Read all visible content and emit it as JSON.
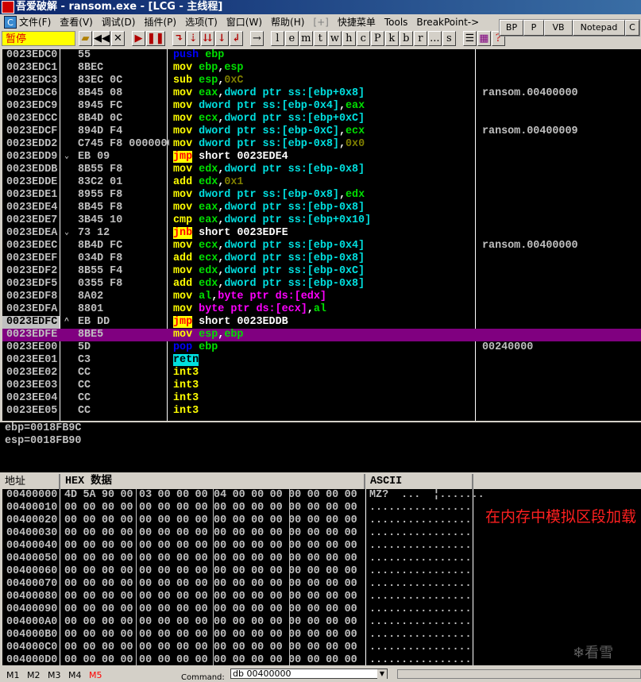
{
  "window": {
    "title": "吾爱破解 - ransom.exe - [LCG -  主线程]",
    "logo": "吾爱破解"
  },
  "menu": {
    "icon": "C",
    "items": [
      "文件(F)",
      "查看(V)",
      "调试(D)",
      "插件(P)",
      "选项(T)",
      "窗口(W)",
      "帮助(H)",
      "[+]",
      "快捷菜单",
      "Tools",
      "BreakPoint->"
    ]
  },
  "toolbar": {
    "state": "暂停",
    "buttons": [
      "l",
      "e",
      "m",
      "t",
      "w",
      "h",
      "c",
      "P",
      "k",
      "b",
      "r",
      "...",
      "s"
    ],
    "float_buttons": [
      "BP",
      "P",
      "VB",
      "Notepad",
      "C"
    ]
  },
  "disasm": {
    "colors": {
      "selected_row": "#800080",
      "mnemonic": "#ffff00",
      "register": "#00e000",
      "memory": "#00e0e0"
    },
    "rows": [
      {
        "addr": "0023EDC0",
        "mark": "",
        "hex": "55",
        "t": [
          [
            "push",
            "b"
          ],
          [
            " ",
            ""
          ],
          [
            "ebp",
            "g"
          ]
        ],
        "cmt": ""
      },
      {
        "addr": "0023EDC1",
        "mark": "",
        "hex": "8BEC",
        "t": [
          [
            "mov",
            "y"
          ],
          [
            " ",
            ""
          ],
          [
            "ebp",
            "g"
          ],
          [
            ",",
            "w"
          ],
          [
            "esp",
            "g"
          ]
        ],
        "cmt": ""
      },
      {
        "addr": "0023EDC3",
        "mark": "",
        "hex": "83EC 0C",
        "t": [
          [
            "sub",
            "y"
          ],
          [
            " ",
            ""
          ],
          [
            "esp",
            "g"
          ],
          [
            ",",
            "w"
          ],
          [
            "0xC",
            "o"
          ]
        ],
        "cmt": ""
      },
      {
        "addr": "0023EDC6",
        "mark": "",
        "hex": "8B45 08",
        "t": [
          [
            "mov",
            "y"
          ],
          [
            " ",
            ""
          ],
          [
            "eax",
            "g"
          ],
          [
            ",",
            "w"
          ],
          [
            "dword ptr ss:[ebp+0x8]",
            "cy"
          ]
        ],
        "cmt": "ransom.00400000"
      },
      {
        "addr": "0023EDC9",
        "mark": "",
        "hex": "8945 FC",
        "t": [
          [
            "mov",
            "y"
          ],
          [
            " ",
            ""
          ],
          [
            "dword ptr ss:[ebp-0x4]",
            "cy"
          ],
          [
            ",",
            "w"
          ],
          [
            "eax",
            "g"
          ]
        ],
        "cmt": ""
      },
      {
        "addr": "0023EDCC",
        "mark": "",
        "hex": "8B4D 0C",
        "t": [
          [
            "mov",
            "y"
          ],
          [
            " ",
            ""
          ],
          [
            "ecx",
            "g"
          ],
          [
            ",",
            "w"
          ],
          [
            "dword ptr ss:[ebp+0xC]",
            "cy"
          ]
        ],
        "cmt": ""
      },
      {
        "addr": "0023EDCF",
        "mark": "",
        "hex": "894D F4",
        "t": [
          [
            "mov",
            "y"
          ],
          [
            " ",
            ""
          ],
          [
            "dword ptr ss:[ebp-0xC]",
            "cy"
          ],
          [
            ",",
            "w"
          ],
          [
            "ecx",
            "g"
          ]
        ],
        "cmt": "ransom.00400009"
      },
      {
        "addr": "0023EDD2",
        "mark": "",
        "hex": "C745 F8 00000000",
        "t": [
          [
            "mov",
            "y"
          ],
          [
            " ",
            ""
          ],
          [
            "dword ptr ss:[ebp-0x8]",
            "cy"
          ],
          [
            ",",
            "w"
          ],
          [
            "0x0",
            "o"
          ]
        ],
        "cmt": ""
      },
      {
        "addr": "0023EDD9",
        "mark": "⌄",
        "hex": "EB 09",
        "t": [
          [
            "jmp",
            "jmp"
          ],
          [
            " ",
            ""
          ],
          [
            "short 0023EDE4",
            "w"
          ]
        ],
        "cmt": ""
      },
      {
        "addr": "0023EDDB",
        "mark": "",
        "hex": "8B55 F8",
        "t": [
          [
            "mov",
            "y"
          ],
          [
            " ",
            ""
          ],
          [
            "edx",
            "g"
          ],
          [
            ",",
            "w"
          ],
          [
            "dword ptr ss:[ebp-0x8]",
            "cy"
          ]
        ],
        "cmt": ""
      },
      {
        "addr": "0023EDDE",
        "mark": "",
        "hex": "83C2 01",
        "t": [
          [
            "add",
            "y"
          ],
          [
            " ",
            ""
          ],
          [
            "edx",
            "g"
          ],
          [
            ",",
            "w"
          ],
          [
            "0x1",
            "o"
          ]
        ],
        "cmt": ""
      },
      {
        "addr": "0023EDE1",
        "mark": "",
        "hex": "8955 F8",
        "t": [
          [
            "mov",
            "y"
          ],
          [
            " ",
            ""
          ],
          [
            "dword ptr ss:[ebp-0x8]",
            "cy"
          ],
          [
            ",",
            "w"
          ],
          [
            "edx",
            "g"
          ]
        ],
        "cmt": ""
      },
      {
        "addr": "0023EDE4",
        "mark": "",
        "hex": "8B45 F8",
        "t": [
          [
            "mov",
            "y"
          ],
          [
            " ",
            ""
          ],
          [
            "eax",
            "g"
          ],
          [
            ",",
            "w"
          ],
          [
            "dword ptr ss:[ebp-0x8]",
            "cy"
          ]
        ],
        "cmt": ""
      },
      {
        "addr": "0023EDE7",
        "mark": "",
        "hex": "3B45 10",
        "t": [
          [
            "cmp",
            "y"
          ],
          [
            " ",
            ""
          ],
          [
            "eax",
            "g"
          ],
          [
            ",",
            "w"
          ],
          [
            "dword ptr ss:[ebp+0x10]",
            "cy"
          ]
        ],
        "cmt": ""
      },
      {
        "addr": "0023EDEA",
        "mark": "⌄",
        "hex": "73 12",
        "t": [
          [
            "jnb",
            "jmp"
          ],
          [
            " ",
            ""
          ],
          [
            "short 0023EDFE",
            "w"
          ]
        ],
        "cmt": ""
      },
      {
        "addr": "0023EDEC",
        "mark": "",
        "hex": "8B4D FC",
        "t": [
          [
            "mov",
            "y"
          ],
          [
            " ",
            ""
          ],
          [
            "ecx",
            "g"
          ],
          [
            ",",
            "w"
          ],
          [
            "dword ptr ss:[ebp-0x4]",
            "cy"
          ]
        ],
        "cmt": "ransom.00400000"
      },
      {
        "addr": "0023EDEF",
        "mark": "",
        "hex": "034D F8",
        "t": [
          [
            "add",
            "y"
          ],
          [
            " ",
            ""
          ],
          [
            "ecx",
            "g"
          ],
          [
            ",",
            "w"
          ],
          [
            "dword ptr ss:[ebp-0x8]",
            "cy"
          ]
        ],
        "cmt": ""
      },
      {
        "addr": "0023EDF2",
        "mark": "",
        "hex": "8B55 F4",
        "t": [
          [
            "mov",
            "y"
          ],
          [
            " ",
            ""
          ],
          [
            "edx",
            "g"
          ],
          [
            ",",
            "w"
          ],
          [
            "dword ptr ss:[ebp-0xC]",
            "cy"
          ]
        ],
        "cmt": ""
      },
      {
        "addr": "0023EDF5",
        "mark": "",
        "hex": "0355 F8",
        "t": [
          [
            "add",
            "y"
          ],
          [
            " ",
            ""
          ],
          [
            "edx",
            "g"
          ],
          [
            ",",
            "w"
          ],
          [
            "dword ptr ss:[ebp-0x8]",
            "cy"
          ]
        ],
        "cmt": ""
      },
      {
        "addr": "0023EDF8",
        "mark": "",
        "hex": "8A02",
        "t": [
          [
            "mov",
            "y"
          ],
          [
            " ",
            ""
          ],
          [
            "al",
            "g"
          ],
          [
            ",",
            "w"
          ],
          [
            "byte ptr ds:[edx]",
            "m"
          ]
        ],
        "cmt": ""
      },
      {
        "addr": "0023EDFA",
        "mark": "",
        "hex": "8801",
        "t": [
          [
            "mov",
            "y"
          ],
          [
            " ",
            ""
          ],
          [
            "byte ptr ds:[ecx]",
            "m"
          ],
          [
            ",",
            "w"
          ],
          [
            "al",
            "g"
          ]
        ],
        "cmt": ""
      },
      {
        "addr": "0023EDFC",
        "mark": "^",
        "hex": "EB DD",
        "t": [
          [
            "jmp",
            "jmp"
          ],
          [
            " ",
            ""
          ],
          [
            "short 0023EDDB",
            "w"
          ]
        ],
        "cmt": "",
        "eip": true
      },
      {
        "addr": "0023EDFE",
        "mark": "",
        "hex": "8BE5",
        "t": [
          [
            "mov",
            "y"
          ],
          [
            " ",
            ""
          ],
          [
            "esp",
            "g"
          ],
          [
            ",",
            "w"
          ],
          [
            "ebp",
            "g"
          ]
        ],
        "cmt": "",
        "selected": true
      },
      {
        "addr": "0023EE00",
        "mark": "",
        "hex": "5D",
        "t": [
          [
            "pop",
            "b"
          ],
          [
            " ",
            ""
          ],
          [
            "ebp",
            "g"
          ]
        ],
        "cmt": "00240000"
      },
      {
        "addr": "0023EE01",
        "mark": "",
        "hex": "C3",
        "t": [
          [
            "retn",
            "ret"
          ]
        ],
        "cmt": ""
      },
      {
        "addr": "0023EE02",
        "mark": "",
        "hex": "CC",
        "t": [
          [
            "int3",
            "y"
          ]
        ],
        "cmt": ""
      },
      {
        "addr": "0023EE03",
        "mark": "",
        "hex": "CC",
        "t": [
          [
            "int3",
            "y"
          ]
        ],
        "cmt": ""
      },
      {
        "addr": "0023EE04",
        "mark": "",
        "hex": "CC",
        "t": [
          [
            "int3",
            "y"
          ]
        ],
        "cmt": ""
      },
      {
        "addr": "0023EE05",
        "mark": "",
        "hex": "CC",
        "t": [
          [
            "int3",
            "y"
          ]
        ],
        "cmt": ""
      }
    ]
  },
  "info": {
    "lines": [
      "ebp=0018FB9C",
      "esp=0018FB90"
    ]
  },
  "dump": {
    "headers": {
      "addr": "地址",
      "hex": "HEX 数据",
      "ascii": "ASCII"
    },
    "rows": [
      {
        "addr": "00400000",
        "bytes": "4D 5A 90 00 03 00 00 00 04 00 00 00 00 00 00 00",
        "ascii": "MZ?  ...  ¦......."
      },
      {
        "addr": "00400010",
        "bytes": "00 00 00 00 00 00 00 00 00 00 00 00 00 00 00 00",
        "ascii": "................"
      },
      {
        "addr": "00400020",
        "bytes": "00 00 00 00 00 00 00 00 00 00 00 00 00 00 00 00",
        "ascii": "................"
      },
      {
        "addr": "00400030",
        "bytes": "00 00 00 00 00 00 00 00 00 00 00 00 00 00 00 00",
        "ascii": "................"
      },
      {
        "addr": "00400040",
        "bytes": "00 00 00 00 00 00 00 00 00 00 00 00 00 00 00 00",
        "ascii": "................"
      },
      {
        "addr": "00400050",
        "bytes": "00 00 00 00 00 00 00 00 00 00 00 00 00 00 00 00",
        "ascii": "................"
      },
      {
        "addr": "00400060",
        "bytes": "00 00 00 00 00 00 00 00 00 00 00 00 00 00 00 00",
        "ascii": "................"
      },
      {
        "addr": "00400070",
        "bytes": "00 00 00 00 00 00 00 00 00 00 00 00 00 00 00 00",
        "ascii": "................"
      },
      {
        "addr": "00400080",
        "bytes": "00 00 00 00 00 00 00 00 00 00 00 00 00 00 00 00",
        "ascii": "................"
      },
      {
        "addr": "00400090",
        "bytes": "00 00 00 00 00 00 00 00 00 00 00 00 00 00 00 00",
        "ascii": "................"
      },
      {
        "addr": "004000A0",
        "bytes": "00 00 00 00 00 00 00 00 00 00 00 00 00 00 00 00",
        "ascii": "................"
      },
      {
        "addr": "004000B0",
        "bytes": "00 00 00 00 00 00 00 00 00 00 00 00 00 00 00 00",
        "ascii": "................"
      },
      {
        "addr": "004000C0",
        "bytes": "00 00 00 00 00 00 00 00 00 00 00 00 00 00 00 00",
        "ascii": "................"
      },
      {
        "addr": "004000D0",
        "bytes": "00 00 00 00 00 00 00 00 00 00 00 00 00 00 00 00",
        "ascii": "................"
      }
    ],
    "annotation": "在内存中模拟区段加载",
    "watermark": "❄看雪"
  },
  "statusbar": {
    "tabs": [
      "M1",
      "M2",
      "M3",
      "M4",
      "M5"
    ],
    "active_tab": "M5",
    "active_color": "#ff0000",
    "command_label": "Command:",
    "command_value": "db 00400000"
  }
}
